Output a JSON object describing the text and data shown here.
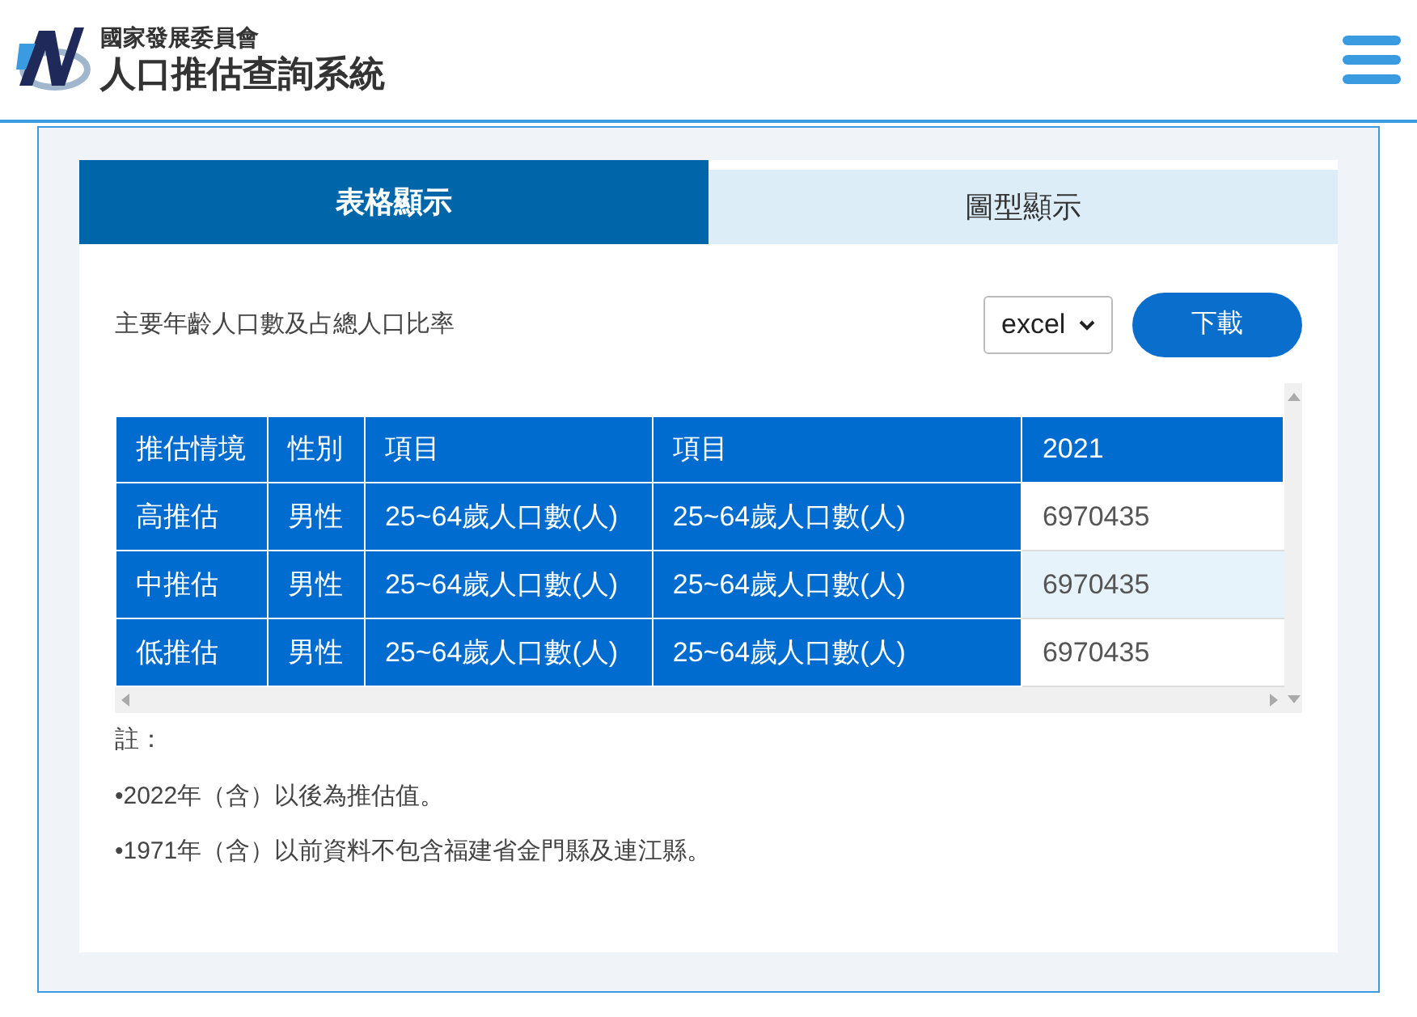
{
  "header": {
    "org": "國家發展委員會",
    "title": "人口推估查詢系統"
  },
  "tabs": [
    {
      "label": "表格顯示",
      "selected": true
    },
    {
      "label": "圖型顯示",
      "selected": false
    }
  ],
  "report_title": "主要年齡人口數及占總人口比率",
  "format_select": {
    "value": "excel"
  },
  "download_button": "下載",
  "table": {
    "columns": [
      "推估情境",
      "性別",
      "項目",
      "項目",
      "2021"
    ],
    "rows": [
      {
        "cells": [
          "高推估",
          "男性",
          "25~64歲人口數(人)",
          "25~64歲人口數(人)",
          "6970435"
        ],
        "selected": false
      },
      {
        "cells": [
          "中推估",
          "男性",
          "25~64歲人口數(人)",
          "25~64歲人口數(人)",
          "6970435"
        ],
        "selected": true
      },
      {
        "cells": [
          "低推估",
          "男性",
          "25~64歲人口數(人)",
          "25~64歲人口數(人)",
          "6970435"
        ],
        "selected": false
      }
    ]
  },
  "notes": {
    "heading": "註：",
    "items": [
      "•2022年（含）以後為推估值。",
      "•1971年（含）以前資料不包含福建省金門縣及連江縣。"
    ]
  }
}
